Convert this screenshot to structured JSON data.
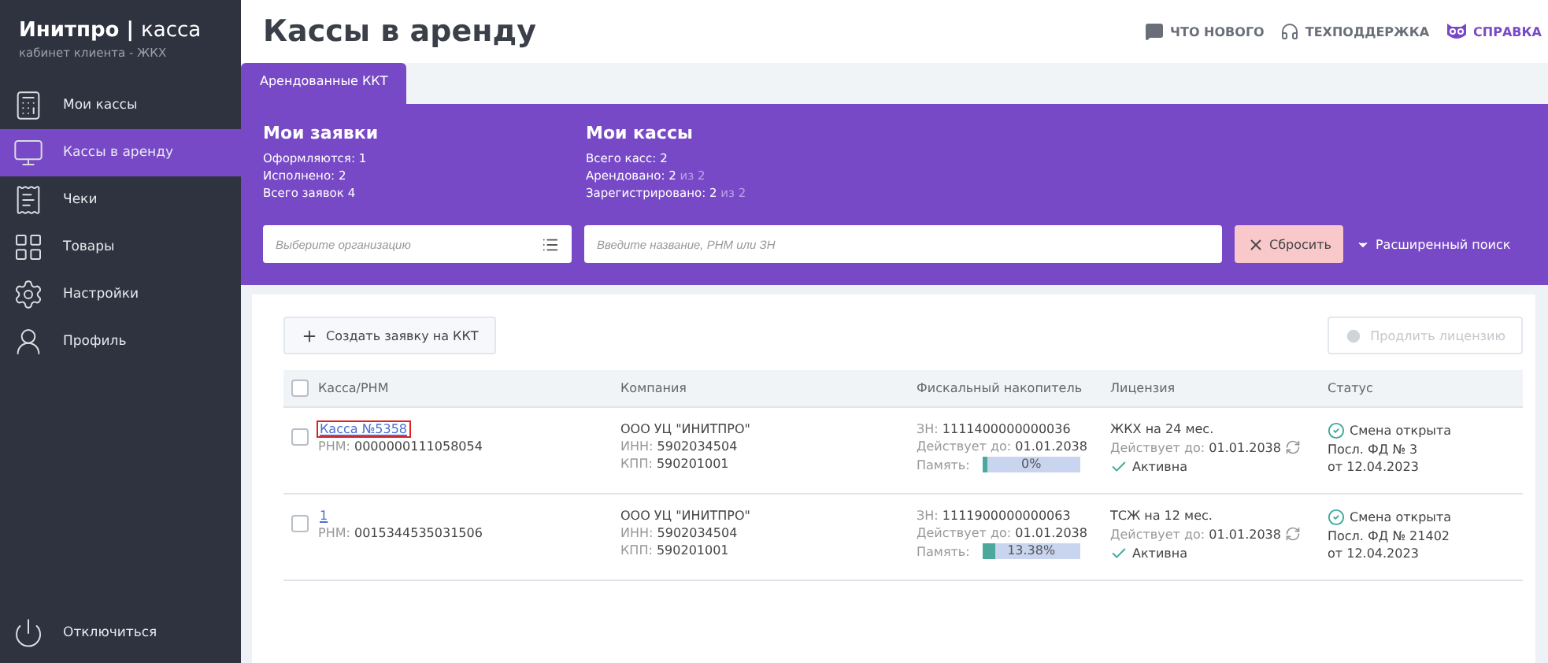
{
  "brand": {
    "name": "Инитпро",
    "separator": "|",
    "product": "касса",
    "subtitle": "кабинет клиента - ЖКХ"
  },
  "sidebar": {
    "items": [
      {
        "kind": "registers",
        "label": "Мои кассы",
        "selected": false
      },
      {
        "kind": "rent",
        "label": "Кассы в аренду",
        "selected": true
      },
      {
        "kind": "receipts",
        "label": "Чеки",
        "selected": false
      },
      {
        "kind": "goods",
        "label": "Товары",
        "selected": false
      },
      {
        "kind": "settings",
        "label": "Настройки",
        "selected": false
      },
      {
        "kind": "profile",
        "label": "Профиль",
        "selected": false
      }
    ],
    "logout": "Отключиться"
  },
  "page_title": "Кассы в аренду",
  "top_links": [
    {
      "kind": "news",
      "label": "ЧТО НОВОГО"
    },
    {
      "kind": "support",
      "label": "ТЕХПОДДЕРЖКА"
    },
    {
      "kind": "help",
      "label": "СПРАВКА"
    }
  ],
  "tabs": [
    {
      "label": "Арендованные ККТ",
      "selected": true
    }
  ],
  "summary": [
    {
      "title": "Мои заявки",
      "lines": [
        {
          "label": "Оформляются: 1"
        },
        {
          "label": "Исполнено: 2"
        },
        {
          "label": "Всего заявок 4"
        }
      ]
    },
    {
      "title": "Мои кассы",
      "lines": [
        {
          "label": "Всего касс: 2"
        },
        {
          "label": "Арендовано: 2",
          "suffix": "из 2"
        },
        {
          "label": "Зарегистрировано: 2",
          "suffix": "из 2"
        }
      ]
    }
  ],
  "filters": {
    "organization": {
      "placeholder": "Выберите организацию"
    },
    "search": {
      "placeholder": "Введите название, РНМ или ЗН"
    },
    "reset": "Сбросить",
    "advanced": "Расширенный поиск"
  },
  "actions": {
    "create": "Создать заявку на ККТ",
    "extend": {
      "label": "Продлить лицензию",
      "disabled": true
    }
  },
  "table": {
    "columns": [
      "Касса/РНМ",
      "Компания",
      "Фискальный накопитель",
      "Лицензия",
      "Статус"
    ],
    "header_checked": false,
    "rows": [
      {
        "checked": false,
        "highlighted": true,
        "name": "Касса №5358",
        "rnm_label": "РНМ:",
        "rnm": "0000000111058054",
        "company": "ООО УЦ \"ИНИТПРО\"",
        "inn_label": "ИНН:",
        "inn": "5902034504",
        "kpp_label": "КПП:",
        "kpp": "590201001",
        "zn_label": "ЗН:",
        "zn": "1111400000000036",
        "fn_valid_label": "Действует до:",
        "fn_valid": "01.01.2038",
        "memory_label": "Память:",
        "memory": "0%",
        "level": 0,
        "license": "ЖКХ на 24 мес.",
        "lic_valid_label": "Действует до:",
        "lic_valid": "01.01.2038",
        "license_state": "Активна",
        "status": "Смена открыта",
        "last_doc": "Посл. ФД № 3",
        "date": "от 12.04.2023"
      },
      {
        "checked": false,
        "highlighted": false,
        "name": "1",
        "rnm_label": "РНМ:",
        "rnm": "0015344535031506",
        "company": "ООО УЦ \"ИНИТПРО\"",
        "inn_label": "ИНН:",
        "inn": "5902034504",
        "kpp_label": "КПП:",
        "kpp": "590201001",
        "zn_label": "ЗН:",
        "zn": "1111900000000063",
        "fn_valid_label": "Действует до:",
        "fn_valid": "01.01.2038",
        "memory_label": "Память:",
        "memory": "13.38%",
        "level": 0.1338,
        "license": "ТСЖ на 12 мес.",
        "lic_valid_label": "Действует до:",
        "lic_valid": "01.01.2038",
        "license_state": "Активна",
        "status": "Смена открыта",
        "last_doc": "Посл. ФД № 21402",
        "date": "от 12.04.2023"
      }
    ]
  }
}
